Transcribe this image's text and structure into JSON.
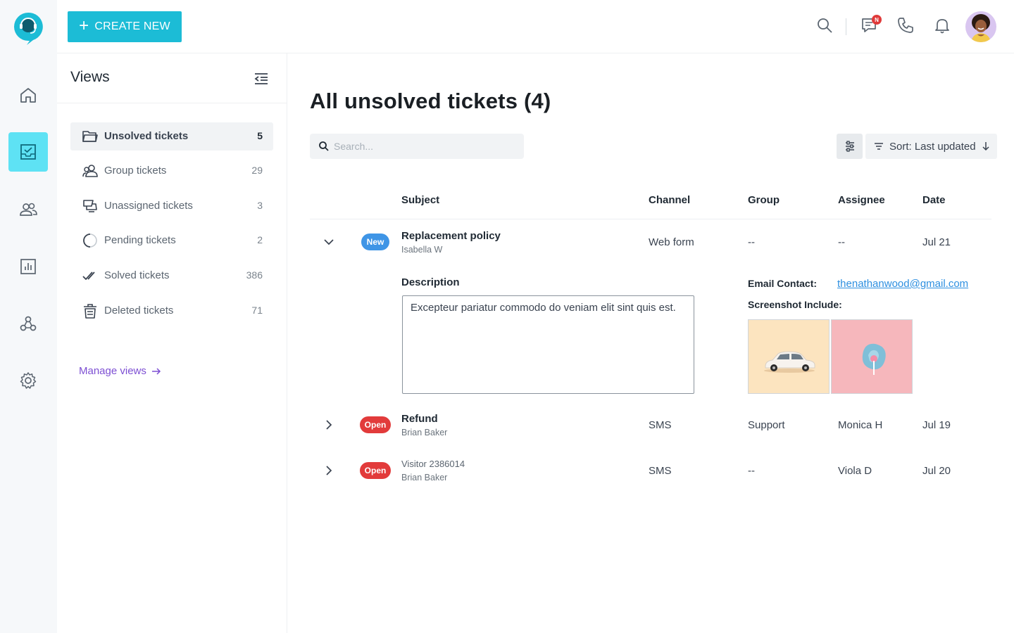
{
  "nav": {
    "items": [
      {
        "name": "home",
        "icon": "home-icon",
        "active": false
      },
      {
        "name": "tickets",
        "icon": "inbox-check-icon",
        "active": true
      },
      {
        "name": "contacts",
        "icon": "users-icon",
        "active": false
      },
      {
        "name": "reports",
        "icon": "bar-chart-icon",
        "active": false
      },
      {
        "name": "workflows",
        "icon": "workflow-icon",
        "active": false
      },
      {
        "name": "settings",
        "icon": "gear-icon",
        "active": false
      }
    ]
  },
  "topbar": {
    "create_label": "CREATE NEW",
    "notification_badge": "N",
    "icons": [
      "search-icon",
      "chat-icon",
      "phone-icon",
      "bell-icon"
    ]
  },
  "views": {
    "title": "Views",
    "items": [
      {
        "label": "Unsolved tickets",
        "count": "5",
        "icon": "folder-icon",
        "active": true
      },
      {
        "label": "Group tickets",
        "count": "29",
        "icon": "group-icon",
        "active": false
      },
      {
        "label": "Unassigned tickets",
        "count": "3",
        "icon": "unassigned-icon",
        "active": false
      },
      {
        "label": "Pending tickets",
        "count": "2",
        "icon": "pending-icon",
        "active": false
      },
      {
        "label": "Solved tickets",
        "count": "386",
        "icon": "double-check-icon",
        "active": false
      },
      {
        "label": "Deleted tickets",
        "count": "71",
        "icon": "trash-icon",
        "active": false
      }
    ],
    "manage_label": "Manage views"
  },
  "main": {
    "title": "All unsolved tickets (4)",
    "search_placeholder": "Search...",
    "sort_label": "Sort: Last updated",
    "columns": {
      "subject": "Subject",
      "channel": "Channel",
      "group": "Group",
      "assignee": "Assignee",
      "date": "Date"
    },
    "tickets": [
      {
        "status": "New",
        "subject": "Replacement policy",
        "requester": "Isabella W",
        "channel": "Web form",
        "group": "--",
        "assignee": "--",
        "date": "Jul 21",
        "expanded": true
      },
      {
        "status": "Open",
        "subject": "Refund",
        "requester": "Brian Baker",
        "channel": "SMS",
        "group": "Support",
        "assignee": "Monica H",
        "date": "Jul 19",
        "expanded": false
      },
      {
        "status": "Open",
        "subject": "Visitor 2386014",
        "requester": "Brian Baker",
        "channel": "SMS",
        "group": "--",
        "assignee": "Viola D",
        "date": "Jul 20",
        "expanded": false
      }
    ],
    "detail": {
      "description_label": "Description",
      "description": "Excepteur pariatur commodo do veniam elit sint quis est.",
      "email_label": "Email Contact:",
      "email": "thenathanwood@gmail.com",
      "screenshots_label": "Screenshot Include:"
    }
  },
  "colors": {
    "accent": "#1cbcd6",
    "active_nav": "#5ee2f4",
    "new_badge": "#3f95e6",
    "open_badge": "#e23b3b",
    "link": "#2d8fe0",
    "manage_link": "#7d4fd3"
  }
}
